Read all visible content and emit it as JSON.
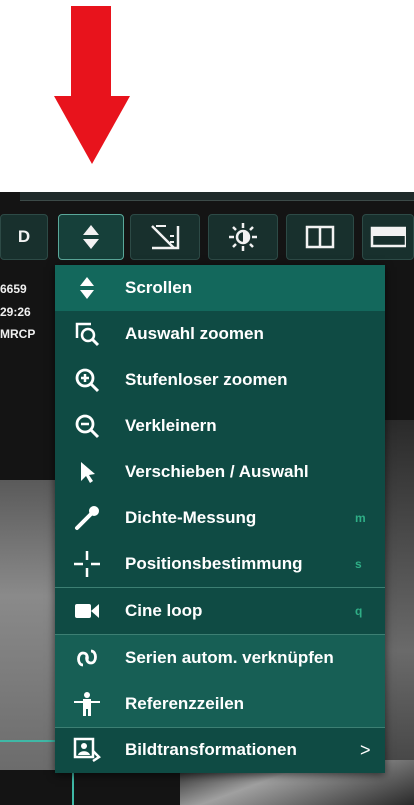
{
  "annotation": {
    "arrow_color": "#e8131c"
  },
  "toolbar": {
    "first_label": "D",
    "buttons": [
      {
        "icon": "up-down-arrows-icon",
        "active": true
      },
      {
        "icon": "ruler-triangle-icon"
      },
      {
        "icon": "brightness-icon"
      },
      {
        "icon": "split-layout-icon"
      },
      {
        "icon": "layout-icon"
      }
    ]
  },
  "overlay": {
    "lines": [
      "6659",
      "29:26",
      "MRCP"
    ]
  },
  "menu": {
    "items": [
      {
        "label": "Scrollen",
        "icon": "up-down-arrows-icon",
        "shortcut": ""
      },
      {
        "label": "Auswahl zoomen",
        "icon": "zoom-region-icon",
        "shortcut": ""
      },
      {
        "label": "Stufenloser zoomen",
        "icon": "zoom-in-icon",
        "shortcut": ""
      },
      {
        "label": "Verkleinern",
        "icon": "zoom-out-icon",
        "shortcut": ""
      },
      {
        "label": "Verschieben / Auswahl",
        "icon": "pointer-icon",
        "shortcut": ""
      },
      {
        "label": "Dichte-Messung",
        "icon": "pipette-icon",
        "shortcut": "m"
      },
      {
        "label": "Positionsbestimmung",
        "icon": "crosshair-icon",
        "shortcut": "s"
      },
      {
        "label": "Cine loop",
        "icon": "video-camera-icon",
        "shortcut": "q"
      },
      {
        "label": "Serien autom. verknüpfen",
        "icon": "link-icon",
        "shortcut": ""
      },
      {
        "label": "Referenzzeilen",
        "icon": "reference-lines-icon",
        "shortcut": ""
      },
      {
        "label": "Bildtransformationen",
        "icon": "image-transform-icon",
        "shortcut": "",
        "submenu": ">"
      }
    ]
  }
}
